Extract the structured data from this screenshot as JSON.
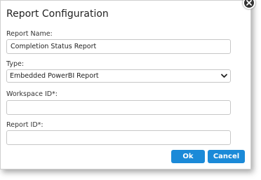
{
  "dialog": {
    "title": "Report Configuration",
    "close_icon": "close-icon"
  },
  "form": {
    "report_name": {
      "label": "Report Name:",
      "value": "Completion Status Report"
    },
    "type": {
      "label": "Type:",
      "selected": "Embedded PowerBI Report",
      "icon": "chevron-down-icon"
    },
    "workspace_id": {
      "label": "Workspace ID*:",
      "value": ""
    },
    "report_id": {
      "label": "Report ID*:",
      "value": ""
    }
  },
  "buttons": {
    "ok": "Ok",
    "cancel": "Cancel"
  },
  "colors": {
    "primary_button": "#1b8ad8",
    "close_button": "#333333"
  }
}
